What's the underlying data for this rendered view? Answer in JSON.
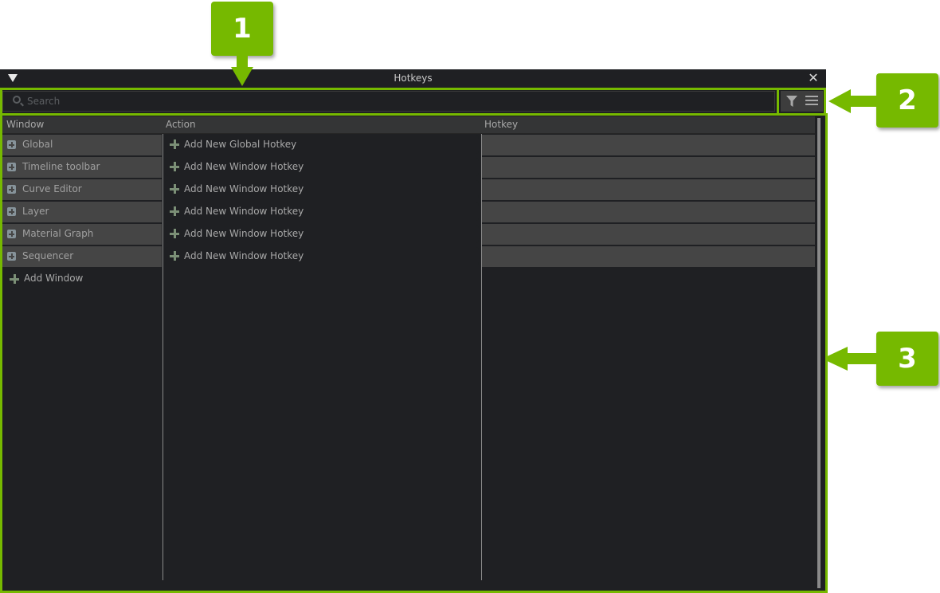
{
  "window": {
    "title": "Hotkeys",
    "menu_icon": "triangle-down-icon",
    "close_icon": "close-icon"
  },
  "search": {
    "placeholder": "Search",
    "value": "",
    "icon": "search-icon"
  },
  "toolbar": {
    "filter_icon": "filter-icon",
    "menu_icon": "hamburger-menu-icon"
  },
  "table": {
    "columns": [
      "Window",
      "Action",
      "Hotkey"
    ],
    "rows": [
      {
        "window": "Global",
        "action": "Add New Global Hotkey",
        "hotkey": ""
      },
      {
        "window": "Timeline toolbar",
        "action": "Add New Window Hotkey",
        "hotkey": ""
      },
      {
        "window": "Curve Editor",
        "action": "Add New Window Hotkey",
        "hotkey": ""
      },
      {
        "window": "Layer",
        "action": "Add New Window Hotkey",
        "hotkey": ""
      },
      {
        "window": "Material Graph",
        "action": "Add New Window Hotkey",
        "hotkey": ""
      },
      {
        "window": "Sequencer",
        "action": "Add New Window Hotkey",
        "hotkey": ""
      }
    ],
    "add_window_label": "Add Window"
  },
  "callouts": [
    "1",
    "2",
    "3"
  ],
  "colors": {
    "accent": "#76b900",
    "background": "#1f2023",
    "row": "#454545",
    "header": "#343536"
  }
}
